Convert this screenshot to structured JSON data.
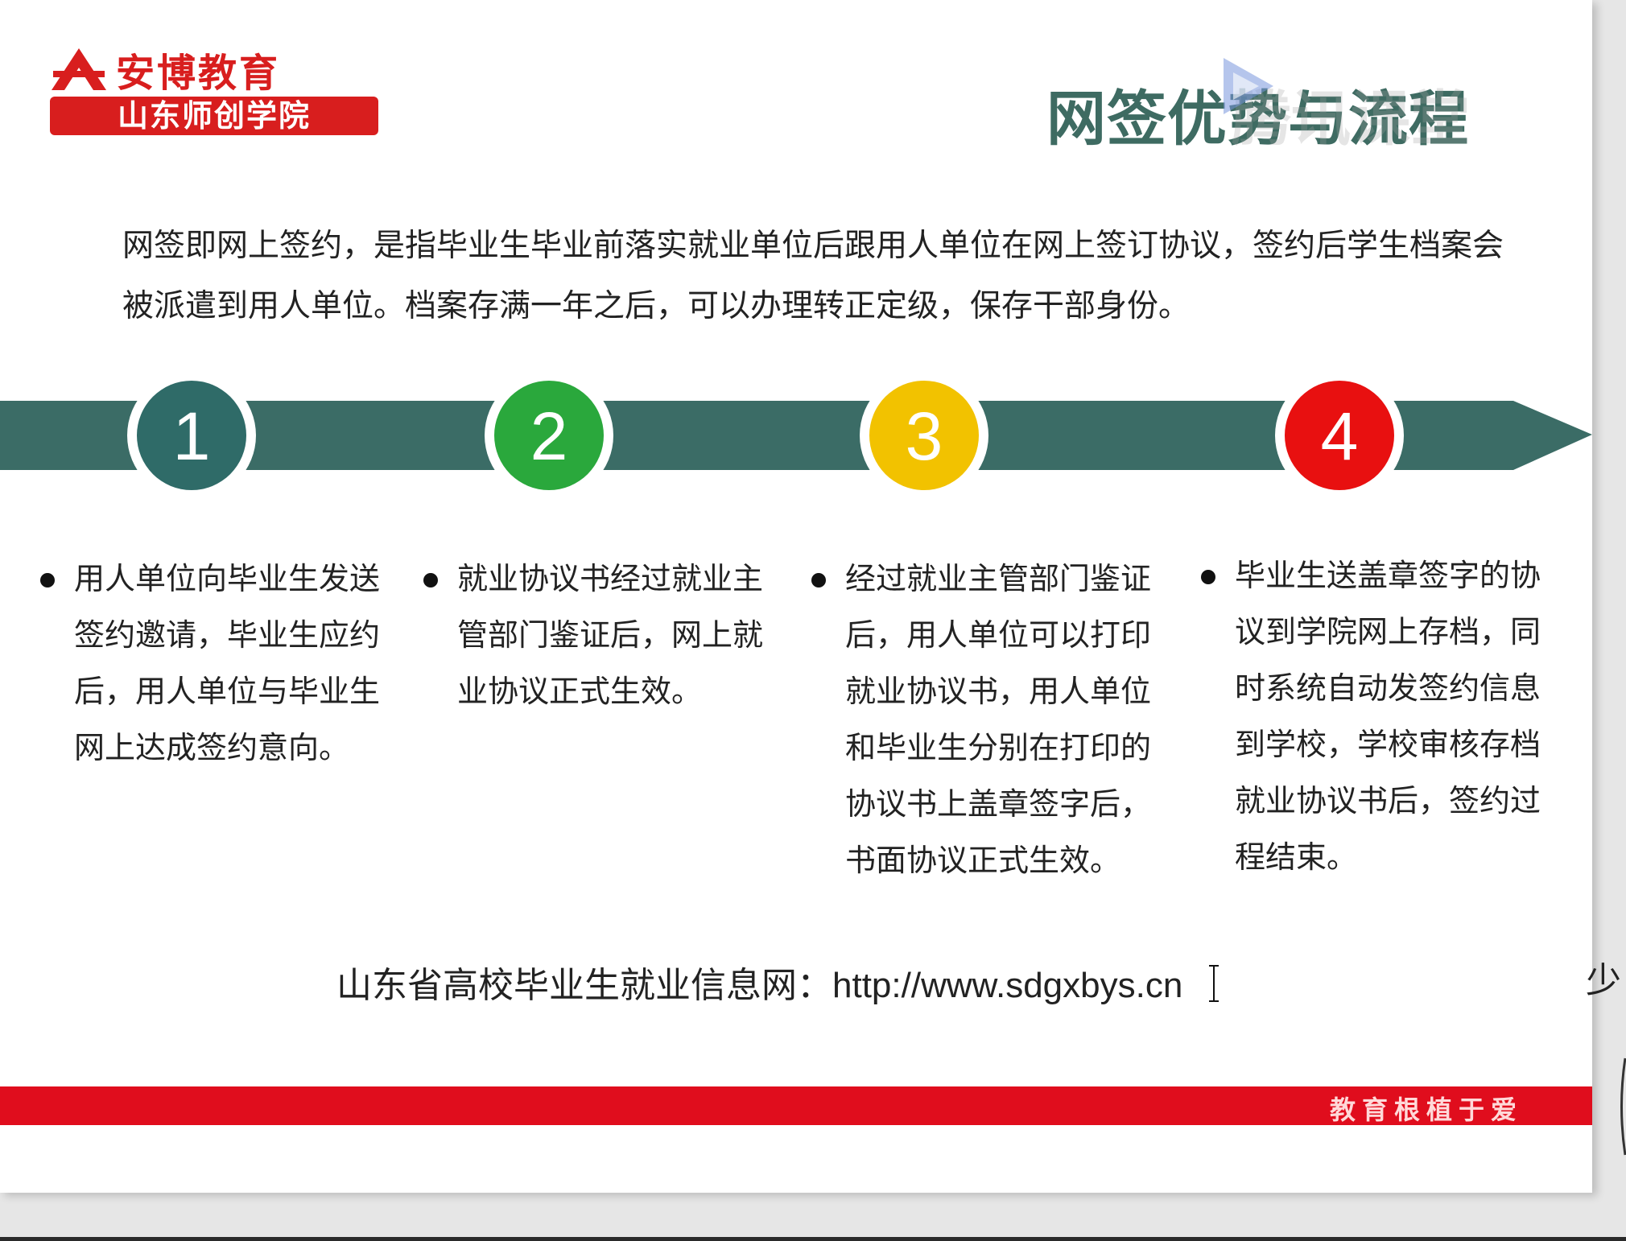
{
  "logo": {
    "brand": "安博教育",
    "band": "山东师创学院"
  },
  "title": "网签优势与流程",
  "watermark": "腾讯课堂",
  "intro": "网签即网上签约，是指毕业生毕业前落实就业单位后跟用人单位在网上签订协议，签约后学生档案会被派遣到用人单位。档案存满一年之后，可以办理转正定级，保存干部身份。",
  "steps": [
    {
      "num": "1",
      "color": "#2f6b68"
    },
    {
      "num": "2",
      "color": "#2aa83c"
    },
    {
      "num": "3",
      "color": "#f2c200"
    },
    {
      "num": "4",
      "color": "#e81010"
    }
  ],
  "timeline_color": "#3b6c66",
  "columns": [
    {
      "lines": [
        "用人单位向毕业生发送",
        "签约邀请，毕业生应约",
        "后，用人单位与毕业生",
        "网上达成签约意向。"
      ]
    },
    {
      "lines": [
        "就业协议书经过就业主",
        "管部门鉴证后，网上就",
        "业协议正式生效。"
      ]
    },
    {
      "lines": [
        "经过就业主管部门鉴证",
        "后，用人单位可以打印",
        "就业协议书，用人单位",
        "和毕业生分别在打印的",
        "协议书上盖章签字后，",
        "书面协议正式生效。"
      ]
    },
    {
      "lines": [
        "毕业生送盖章签字的协",
        "议到学院网上存档，同",
        "时系统自动发签约信息",
        "到学校，学校审核存档",
        "就业协议书后，签约过",
        "程结束。"
      ]
    }
  ],
  "footer": {
    "label": "山东省高校毕业生就业信息网：",
    "url": "http://www.sdgxbys.cn"
  },
  "motto": "教育根植于爱",
  "side_char": "少"
}
